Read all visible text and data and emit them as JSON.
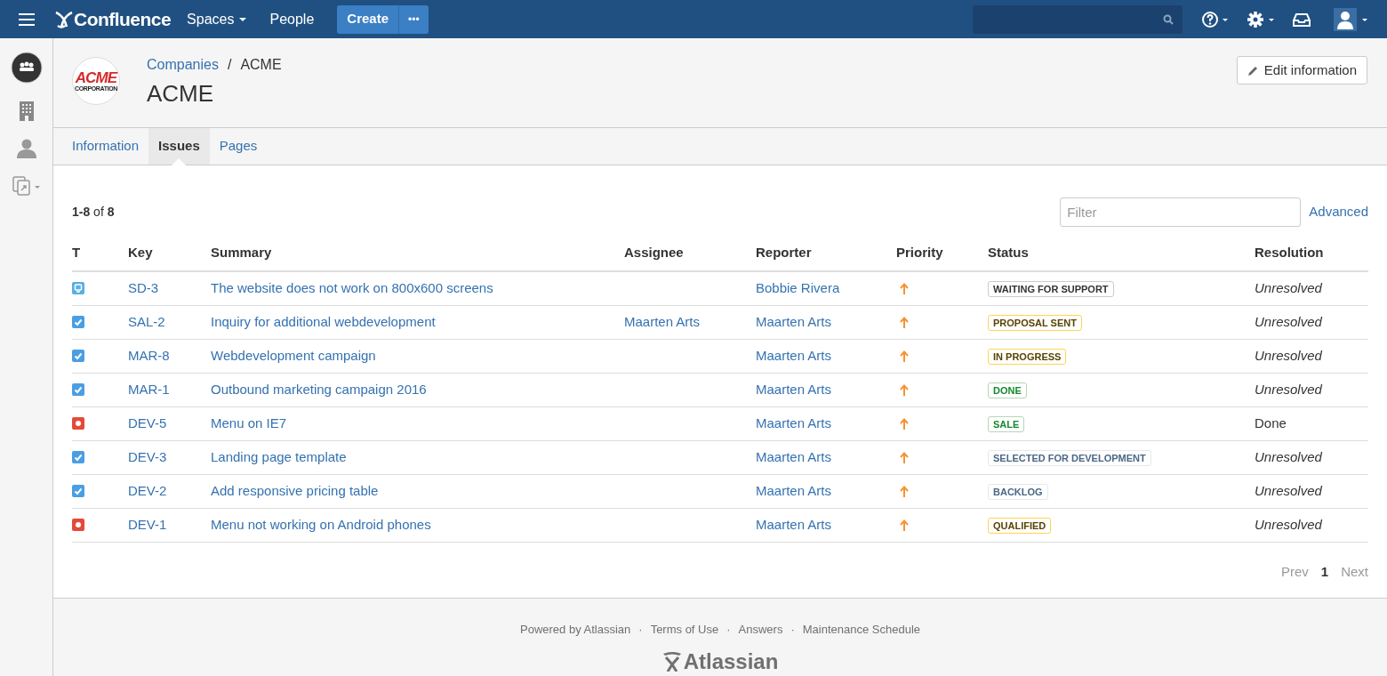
{
  "topbar": {
    "logo": "Confluence",
    "nav": [
      {
        "label": "Spaces",
        "dropdown": true
      },
      {
        "label": "People",
        "dropdown": false
      }
    ],
    "create": "Create",
    "more": "•••"
  },
  "header": {
    "logo_text": "ACME",
    "logo_subtext": "CORPORATION",
    "breadcrumb": [
      "Companies",
      "ACME"
    ],
    "breadcrumb_separator": "/",
    "title": "ACME",
    "edit_button": "Edit information"
  },
  "tabs": [
    {
      "label": "Information",
      "selected": false
    },
    {
      "label": "Issues",
      "selected": true
    },
    {
      "label": "Pages",
      "selected": false
    }
  ],
  "issues": {
    "count_range": "1-8",
    "count_of": "of",
    "count_total": "8",
    "filter_placeholder": "Filter",
    "advanced": "Advanced",
    "columns": [
      "T",
      "Key",
      "Summary",
      "Assignee",
      "Reporter",
      "Priority",
      "Status",
      "Resolution"
    ],
    "rows": [
      {
        "kind": "service",
        "key": "SD-3",
        "summary": "The website does not work on 800x600 screens",
        "reporter": "Bobbie Rivera",
        "status": {
          "label": "WAITING FOR SUPPORT",
          "kind": "neutral"
        },
        "resolution": "Unresolved",
        "resolved": false
      },
      {
        "kind": "task",
        "key": "SAL-2",
        "summary": "Inquiry for additional webdevelopment",
        "assignee": "Maarten Arts",
        "reporter": "Maarten Arts",
        "status": {
          "label": "PROPOSAL SENT",
          "kind": "current"
        },
        "resolution": "Unresolved",
        "resolved": false
      },
      {
        "kind": "task",
        "key": "MAR-8",
        "summary": "Webdevelopment campaign",
        "reporter": "Maarten Arts",
        "status": {
          "label": "IN PROGRESS",
          "kind": "current"
        },
        "resolution": "Unresolved",
        "resolved": false
      },
      {
        "kind": "task",
        "key": "MAR-1",
        "summary": "Outbound marketing campaign 2016",
        "reporter": "Maarten Arts",
        "status": {
          "label": "DONE",
          "kind": "success"
        },
        "resolution": "Unresolved",
        "resolved": false
      },
      {
        "kind": "bug",
        "key": "DEV-5",
        "summary": "Menu on IE7",
        "reporter": "Maarten Arts",
        "status": {
          "label": "SALE",
          "kind": "success"
        },
        "resolution": "Done",
        "resolved": true
      },
      {
        "kind": "task",
        "key": "DEV-3",
        "summary": "Landing page template",
        "reporter": "Maarten Arts",
        "status": {
          "label": "SELECTED FOR DEVELOPMENT",
          "kind": "new"
        },
        "resolution": "Unresolved",
        "resolved": false
      },
      {
        "kind": "task",
        "key": "DEV-2",
        "summary": "Add responsive pricing table",
        "reporter": "Maarten Arts",
        "status": {
          "label": "BACKLOG",
          "kind": "new"
        },
        "resolution": "Unresolved",
        "resolved": false
      },
      {
        "kind": "bug",
        "key": "DEV-1",
        "summary": "Menu not working on Android phones",
        "reporter": "Maarten Arts",
        "status": {
          "label": "QUALIFIED",
          "kind": "current"
        },
        "resolution": "Unresolved",
        "resolved": false
      }
    ],
    "pager": {
      "prev": "Prev",
      "page": "1",
      "next": "Next"
    }
  },
  "footer": {
    "links": [
      "Powered by Atlassian",
      "Terms of Use",
      "Answers",
      "Maintenance Schedule"
    ],
    "separator": "·",
    "brand": "Atlassian"
  }
}
